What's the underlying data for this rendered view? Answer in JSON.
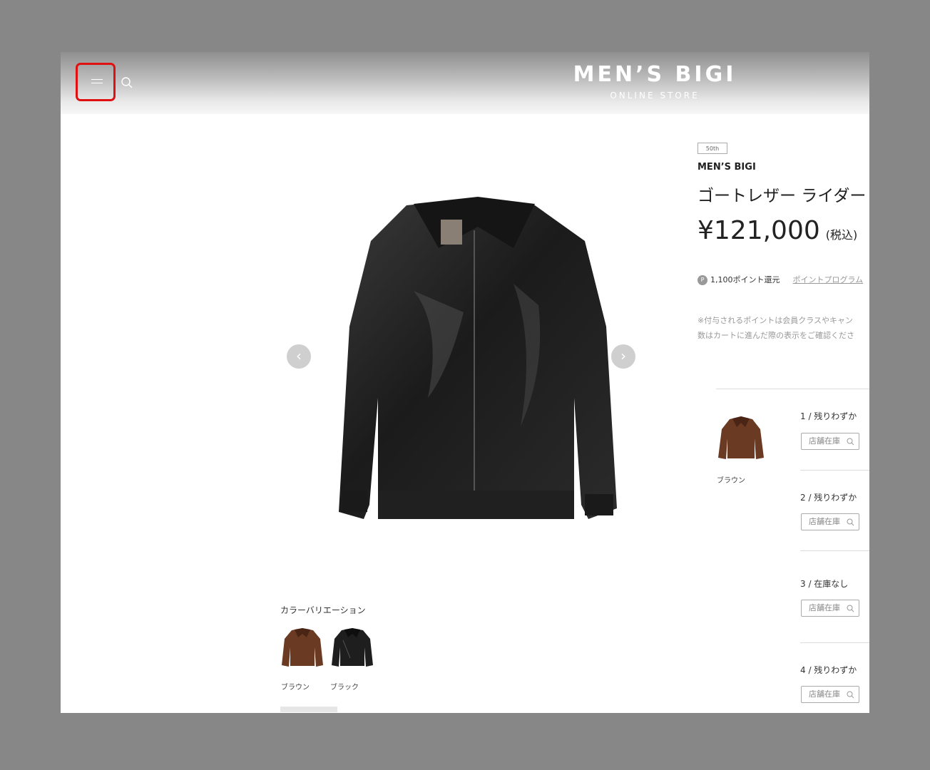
{
  "header": {
    "logo_main": "MEN’S BIGI",
    "logo_sub": "ONLINE STORE"
  },
  "product": {
    "badge": "50th",
    "brand": "MEN’S BIGI",
    "title": "ゴートレザー ライダー",
    "price": "¥121,000",
    "tax_label": "(税込)",
    "points_icon": "P",
    "points_text": "1,100ポイント還元",
    "points_link": "ポイントプログラム",
    "note_line1": "※付与されるポイントは会員クラスやキャン",
    "note_line2": "数はカートに進んだ際の表示をご確認くださ"
  },
  "gallery": {
    "prev_glyph": "‹",
    "next_glyph": "›"
  },
  "color_variation": {
    "label": "カラーバリエーション",
    "colors": [
      {
        "name": "ブラウン",
        "hex": "#6b3a22"
      },
      {
        "name": "ブラック",
        "hex": "#1e1e1e"
      }
    ]
  },
  "sizes": {
    "thumb_label": "ブラウン",
    "button_label": "店舗在庫",
    "items": [
      {
        "label": "1 / 残りわずか"
      },
      {
        "label": "2 / 残りわずか"
      },
      {
        "label": "3 / 在庫なし"
      },
      {
        "label": "4 / 残りわずか"
      }
    ]
  },
  "colors": {
    "highlight": "#e01010",
    "backdrop": "#878787"
  }
}
